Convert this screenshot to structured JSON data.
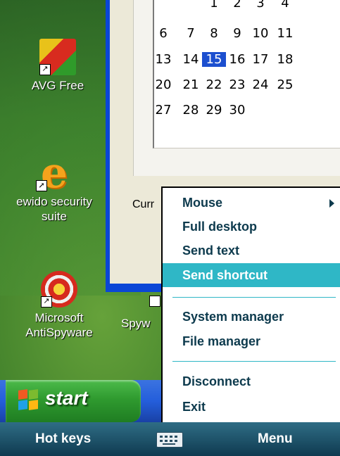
{
  "desktop": {
    "icons": [
      {
        "label": "AVG Free",
        "icon": "avg-icon"
      },
      {
        "label": "ewido security suite",
        "icon": "ewido-icon"
      },
      {
        "label": "Microsoft AntiSpyware",
        "icon": "antispyware-icon"
      },
      {
        "label": "Spyw",
        "icon": "spyware-icon"
      }
    ]
  },
  "calendar": {
    "weeks": [
      [
        "",
        "",
        "",
        "1",
        "2",
        "3",
        "4"
      ],
      [
        "",
        "6",
        "7",
        "8",
        "9",
        "10",
        "11"
      ],
      [
        "",
        "13",
        "14",
        "15",
        "16",
        "17",
        "18"
      ],
      [
        "",
        "20",
        "21",
        "22",
        "23",
        "24",
        "25"
      ],
      [
        "",
        "27",
        "28",
        "29",
        "30",
        "",
        ""
      ]
    ],
    "today": "15",
    "current_label": "Curr"
  },
  "taskbar": {
    "start_label": "start"
  },
  "menu": {
    "items": [
      {
        "label": "Mouse",
        "submenu": true
      },
      {
        "label": "Full desktop"
      },
      {
        "label": "Send text"
      },
      {
        "label": "Send shortcut",
        "selected": true
      },
      {
        "label": "System manager"
      },
      {
        "label": "File manager"
      },
      {
        "label": "Disconnect"
      },
      {
        "label": "Exit"
      }
    ]
  },
  "softkeys": {
    "left": "Hot keys",
    "right": "Menu",
    "center_icon": "keyboard-icon"
  },
  "colors": {
    "menu_highlight": "#2fb7c6",
    "window_border": "#0a46d6",
    "start_green": "#2f9a2f",
    "softbar": "#1a4d63"
  }
}
